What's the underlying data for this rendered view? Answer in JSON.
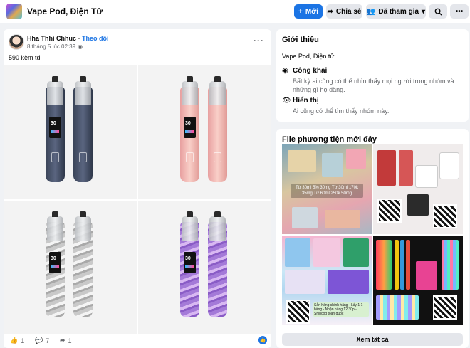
{
  "topbar": {
    "group_name": "Vape Pod, Điện Tử",
    "new_label": "Mới",
    "share_label": "Chia sẻ",
    "joined_label": "Đã tham gia"
  },
  "post": {
    "author": "Hha Thhi Chhuc",
    "follow_label": "Theo dõi",
    "time": "8 tháng 5 lúc 02:39",
    "text": "590 kèm td",
    "photos": [
      {
        "screen_value": "30"
      },
      {
        "screen_value": "30"
      },
      {
        "screen_value": "30"
      },
      {
        "screen_value": "30"
      }
    ],
    "like_count": "1",
    "comment_count": "7",
    "share_count": "1"
  },
  "about": {
    "title": "Giới thiệu",
    "description": "Vape Pod, Điện tử",
    "public_title": "Công khai",
    "public_desc": "Bất kỳ ai cũng có thể nhìn thấy mọi người trong nhóm và những gì họ đăng.",
    "visible_title": "Hiển thị",
    "visible_desc": "Ai cũng có thể tìm thấy nhóm này."
  },
  "media": {
    "title": "File phương tiện mới đây",
    "caption": "Từ 30ml 5% 30mg Từ 30ml 170k 35mg Từ 60ml 250k 50mg",
    "qr_caption": "Sẵn hàng chính hãng - Lấy 1 1 hàng - Nhận hàng 12:30p - Shipcod toàn quốc",
    "see_all_label": "Xem tất cả"
  }
}
